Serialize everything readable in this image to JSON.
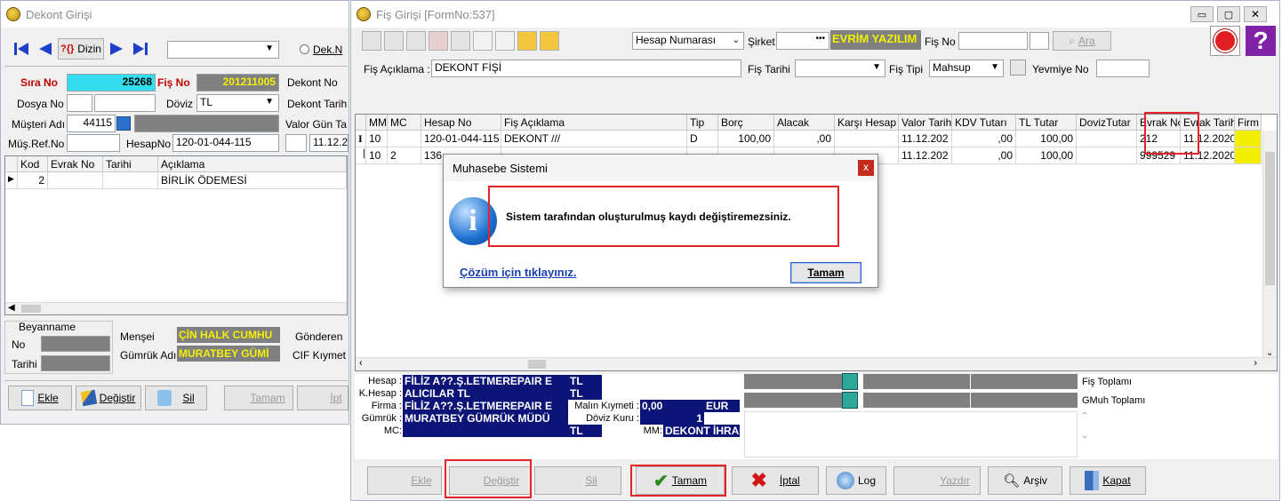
{
  "left": {
    "title": "Dekont Girişi",
    "dizin_label": "Dizin",
    "nav_q": "?{}",
    "dek_n_label": "Dek.N",
    "sira_no_label": "Sıra No",
    "sira_no_value": "25268",
    "fis_no_label": "Fiş No",
    "fis_no_value": "201211005",
    "dekont_no_label": "Dekont No",
    "dosya_no_label": "Dosya No",
    "doviz_label": "Döviz",
    "doviz_value": "TL",
    "dekont_tarih_label": "Dekont Tarih",
    "musteri_adi_label": "Müşteri Adı",
    "musteri_code": "44115",
    "valor_label": "Valor Gün Ta",
    "mus_ref_label": "Müş.Ref.No",
    "hesapno_label": "HesapNo",
    "hesapno_value": "120-01-044-115",
    "date_value": "11.12.2",
    "grid_headers": [
      "Kod",
      "Evrak No",
      "Tarihi",
      "Açıklama"
    ],
    "grid_rows": [
      {
        "kod": "2",
        "evrak": "",
        "tarih": "",
        "aciklama": "BİRLİK ÖDEMESİ"
      }
    ],
    "beyanname_label": "Beyanname",
    "no_label": "No",
    "tarihi_label": "Tarihi",
    "mensei_label": "Menşei",
    "mensei_value": "ÇİN HALK CUMHU",
    "gumruk_adi_label": "Gümrük Adı",
    "gumruk_adi_value": "MURATBEY GÜMİ",
    "gonderen_label": "Gönderen",
    "cif_label": "CIF Kıymet",
    "btn_ekle": "Ekle",
    "btn_degistir": "Değiştir",
    "btn_sil": "Sil",
    "btn_tamam": "Tamam",
    "btn_ipt": "İpt"
  },
  "main": {
    "title": "Fiş Girişi [FormNo:537]",
    "hesap_numarasi": "Hesap Numarası",
    "sirket_label": "Şirket",
    "sirket_dots": "•••",
    "company": "EVRİM YAZILIM",
    "fis_no_label": "Fiş No",
    "ara_label": "Ara",
    "fis_aciklama_label": "Fiş Açıklama :",
    "fis_aciklama_value": "DEKONT FİŞİ",
    "fis_tarihi_label": "Fiş Tarihi",
    "fis_tipi_label": "Fiş Tipi",
    "fis_tipi_value": "Mahsup",
    "yevmiye_label": "Yevmiye No",
    "columns": [
      "MM",
      "MC",
      "Hesap No",
      "Fiş Açıklama",
      "Tip",
      "Borç",
      "Alacak",
      "Karşı Hesap",
      "Valor Tarih",
      "KDV Tutarı",
      "TL Tutar",
      "DovizTutar",
      "Evrak No",
      "Evrak Tarih",
      "Firm"
    ],
    "rows": [
      {
        "ind": "I",
        "mm": "10",
        "mc": "",
        "hesap": "120-01-044-115",
        "aciklama": "DEKONT ///",
        "tip": "D",
        "borc": "100,00",
        "alacak": ",00",
        "karsi": "",
        "valor": "11.12.202",
        "kdv": ",00",
        "tl": "100,00",
        "doviz": "",
        "evrak": "212",
        "evrakt": "11.12.2020"
      },
      {
        "ind": "",
        "mm": "10",
        "mc": "2",
        "hesap": "136",
        "aciklama": "",
        "tip": "",
        "borc": "",
        "alacak": "",
        "karsi": "",
        "valor": "11.12.202",
        "kdv": ",00",
        "tl": "100,00",
        "doviz": "",
        "evrak": "999529",
        "evrakt": "11.12.2020"
      }
    ],
    "info": {
      "hesap_label": "Hesap :",
      "hesap_value": "FİLİZ A??.Ş.LETMEREPAIR E",
      "hesap_cur": "TL",
      "khesap_label": "K.Hesap :",
      "khesap_value": "ALICILAR TL",
      "khesap_cur": "TL",
      "firma_label": "Firma :",
      "firma_value": "FİLİZ A??.Ş.LETMEREPAIR E",
      "malin_label": "Malın Kıymeti :",
      "malin_value": "0,00",
      "malin_cur": "EUR",
      "gumruk_label": "Gümrük :",
      "gumruk_value": "MURATBEY GÜMRÜK MÜDÜ",
      "kur_label": "Döviz Kuru :",
      "kur_value": "1",
      "mc_label": "MC:",
      "mc_cur": "TL",
      "mm_label": "MM:",
      "mm_value": "DEKONT İHRACA",
      "fis_toplami": "Fiş Toplamı",
      "gmuh_toplami": "GMuh Toplamı"
    },
    "buttons": {
      "ekle": "Ekle",
      "degistir": "Değiştir",
      "sil": "Sil",
      "tamam": "Tamam",
      "iptal": "İptal",
      "log": "Log",
      "yazdir": "Yazdır",
      "arsiv": "Arşiv",
      "kapat": "Kapat"
    }
  },
  "dialog": {
    "title": "Muhasebe Sistemi",
    "close": "x",
    "message": "Sistem tarafından oluşturulmuş kaydı değiştiremezsiniz.",
    "link": "Çözüm için tıklayınız.",
    "ok": "Tamam"
  },
  "colors": {
    "cyan": "#33ddee",
    "navy": "#0d1478",
    "highlight": "#f2f000",
    "annotation_red": "#e3242b"
  }
}
